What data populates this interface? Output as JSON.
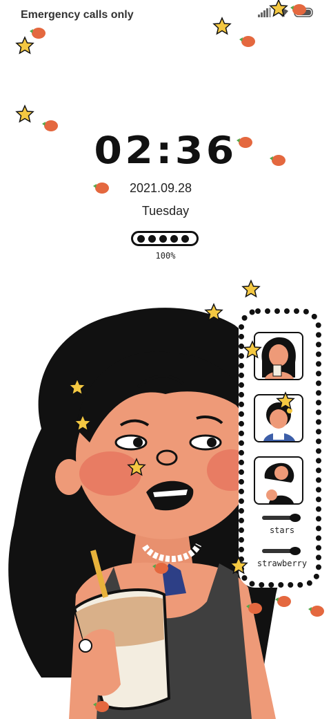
{
  "status_bar": {
    "carrier": "Emergency calls only",
    "icons": [
      "signal-icon",
      "wifi-icon",
      "battery-icon"
    ]
  },
  "lockscreen": {
    "time": "02:36",
    "date": "2021.09.28",
    "weekday": "Tuesday",
    "battery_percent": "100%",
    "battery_level": 1.0
  },
  "widget": {
    "thumbnails": [
      "photo-girl-1",
      "photo-girl-2",
      "photo-girl-3"
    ],
    "toggles": [
      {
        "label": "stars"
      },
      {
        "label": "strawberry"
      }
    ]
  },
  "colors": {
    "skin": "#ee9a78",
    "cheek": "#e87c63",
    "hair": "#111111",
    "star": "#f4c842",
    "strawberry": "#e4683f",
    "leaf": "#55a84b",
    "tank": "#3f3f3f",
    "cup": "#f3ede0",
    "pendant": "#2d3f86"
  }
}
